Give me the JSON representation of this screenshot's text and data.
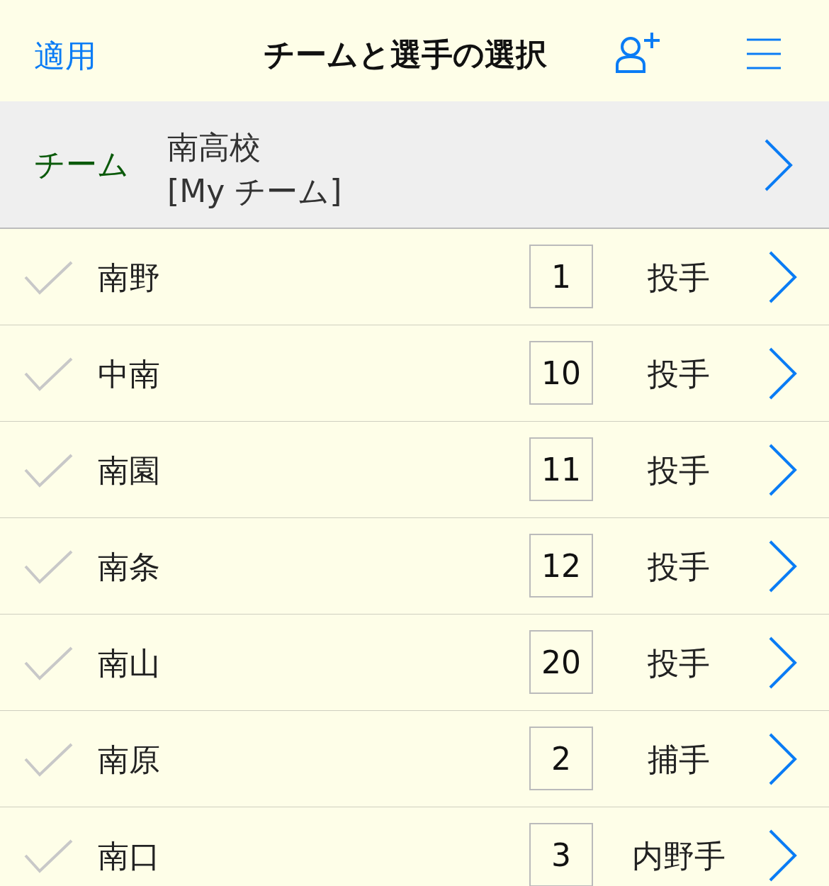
{
  "header": {
    "apply": "適用",
    "title": "チームと選手の選択"
  },
  "team": {
    "label": "チーム",
    "name": "南高校",
    "sub": "[My チーム]"
  },
  "players": [
    {
      "name": "南野",
      "number": "1",
      "position": "投手",
      "checked": false
    },
    {
      "name": "中南",
      "number": "10",
      "position": "投手",
      "checked": false
    },
    {
      "name": "南園",
      "number": "11",
      "position": "投手",
      "checked": false
    },
    {
      "name": "南条",
      "number": "12",
      "position": "投手",
      "checked": false
    },
    {
      "name": "南山",
      "number": "20",
      "position": "投手",
      "checked": false
    },
    {
      "name": "南原",
      "number": "2",
      "position": "捕手",
      "checked": false
    },
    {
      "name": "南口",
      "number": "3",
      "position": "内野手",
      "checked": false
    }
  ]
}
